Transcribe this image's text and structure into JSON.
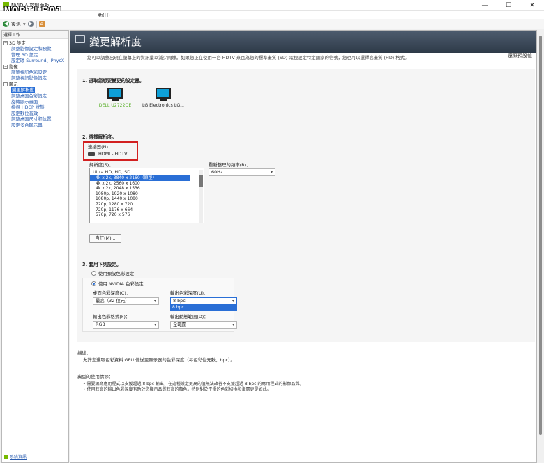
{
  "window": {
    "title": "NVIDIA 控制面板",
    "watermark": "MOBILE01",
    "menu_fragment": "肋(H)",
    "min": "—",
    "max": "☐",
    "close": "✕"
  },
  "toolbar": {
    "back": "後退",
    "fwd_arrow": "▾"
  },
  "sidebar": {
    "header": "選擇工作...",
    "items": [
      {
        "label": "3D 設定",
        "type": "cat",
        "toggle": "−"
      },
      {
        "label": "調整影像設定和預覽",
        "type": "sub"
      },
      {
        "label": "管理 3D 設定",
        "type": "sub"
      },
      {
        "label": "設定環 Surround、PhysX",
        "type": "sub"
      },
      {
        "label": "影像",
        "type": "cat",
        "toggle": "−"
      },
      {
        "label": "調整視訊色彩設定",
        "type": "sub"
      },
      {
        "label": "調整視訊影像設定",
        "type": "sub"
      },
      {
        "label": "顯示",
        "type": "cat",
        "toggle": "−"
      },
      {
        "label": "變更解析度",
        "type": "sub",
        "selected": true
      },
      {
        "label": "調整桌面色彩設定",
        "type": "sub"
      },
      {
        "label": "旋轉顯示畫面",
        "type": "sub"
      },
      {
        "label": "檢視 HDCP 狀態",
        "type": "sub"
      },
      {
        "label": "設定數位音效",
        "type": "sub"
      },
      {
        "label": "調整桌面尺寸和位置",
        "type": "sub"
      },
      {
        "label": "設定多台顯示器",
        "type": "sub"
      }
    ],
    "system_info": "系統資訊"
  },
  "main": {
    "title": "變更解析度",
    "restore": "還原預設值",
    "intro": "您可以調整出現在螢幕上的資訊量以減少閃爍。如果您正在使用一台 HDTV 來且為您的標準畫質 (SD) 電視設定特定國家的信號，您也可以選擇高畫質 (HD) 格式。",
    "step1": "1. 選取您想要變更的設定器。",
    "monitors": [
      {
        "label": "DELL U2722QE"
      },
      {
        "label": "LG Electronics LG..."
      }
    ],
    "step2": "2. 選擇解析度。",
    "connector_label": "連接器(N)：",
    "connector_value": "HDMI - HDTV",
    "resolution_label": "解析度(S)：",
    "resolution_group": "Ultra HD, HD, SD",
    "resolutions": [
      "4k x 2k, 3840 x 2160（原型）",
      "4k x 2k, 2560 x 1600",
      "4k x 2k, 2048 x 1536",
      "1080p, 1920 x 1080",
      "1080p, 1440 x 1080",
      "720p, 1280 x 720",
      "720p, 1176 x 664",
      "576p, 720 x 576"
    ],
    "refresh_label": "重新整理的頻率(R)：",
    "refresh_value": "60Hz",
    "customize": "自訂(M)...",
    "step3": "3. 套用下列設定。",
    "radio_default": "使用預設色彩設定",
    "radio_nvidia": "使用 NVIDIA 色彩設定",
    "desktop_depth_label": "桌面色彩深度(C)：",
    "desktop_depth_value": "最高（32 位元）",
    "output_depth_label": "輸出色彩深度(U)：",
    "output_depth_value": "8 bpc",
    "output_depth_option": "8 bpc",
    "output_format_label": "輸出色彩格式(F)：",
    "output_format_value": "RGB",
    "dynamic_range_label": "輸出動態範圍(D)：",
    "dynamic_range_value": "全範圍",
    "arrow": "▾",
    "desc_title": "描述：",
    "desc_text": "允許您選取色彩資料 GPU 傳送至顯示器的色彩深度（每色彩位元數，bpc）。",
    "usage_title": "典型的使用情節：",
    "usage": [
      "需要編寫應用程式以支援超過 8 bpc 輸出，在這種設定更高的值無法改善不支援超過 8 bpc 的應用程式的影像品質。",
      "使用較高的輸出色彩深度有助於您顯示品質較高的顏色，特別對於平滑的色彩切換和漸層更是如此。"
    ]
  }
}
